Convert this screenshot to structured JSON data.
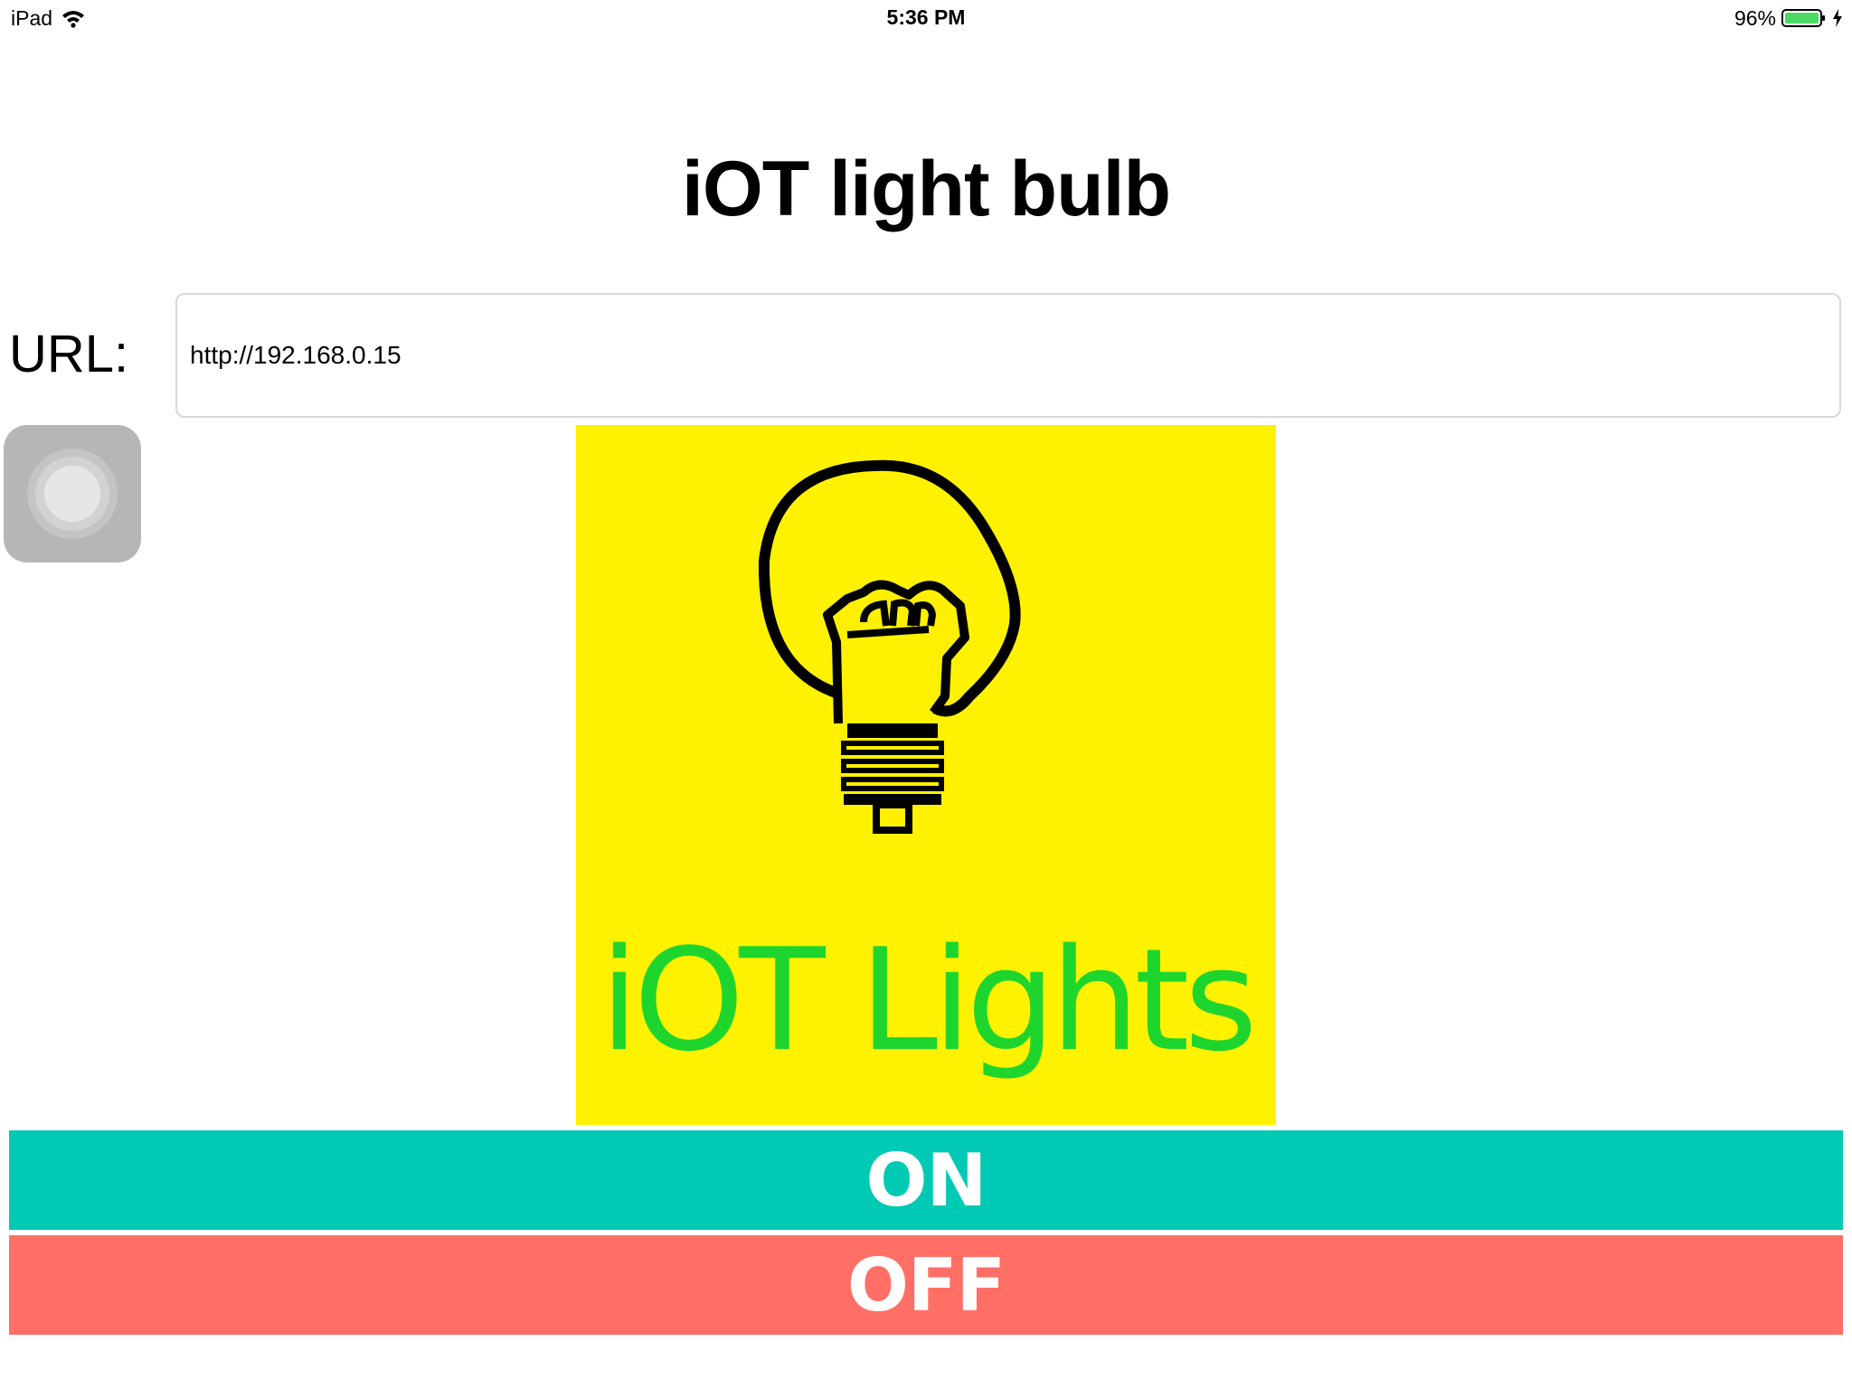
{
  "status_bar": {
    "device": "iPad",
    "time": "5:36 PM",
    "battery_percent": "96%",
    "battery_color": "#4cd964"
  },
  "app": {
    "title": "iOT light bulb",
    "url_label": "URL:",
    "url_value": "http://192.168.0.15",
    "logo_text": "iOT Lights",
    "logo_background": "#fff200",
    "logo_text_color": "#1ed52e"
  },
  "buttons": {
    "on_label": "ON",
    "on_color": "#00c9b4",
    "off_label": "OFF",
    "off_color": "#ff6f66"
  },
  "icons": [
    "wifi-icon",
    "battery-icon",
    "charging-bolt-icon",
    "light-bulb-icon",
    "assistive-touch-icon"
  ]
}
